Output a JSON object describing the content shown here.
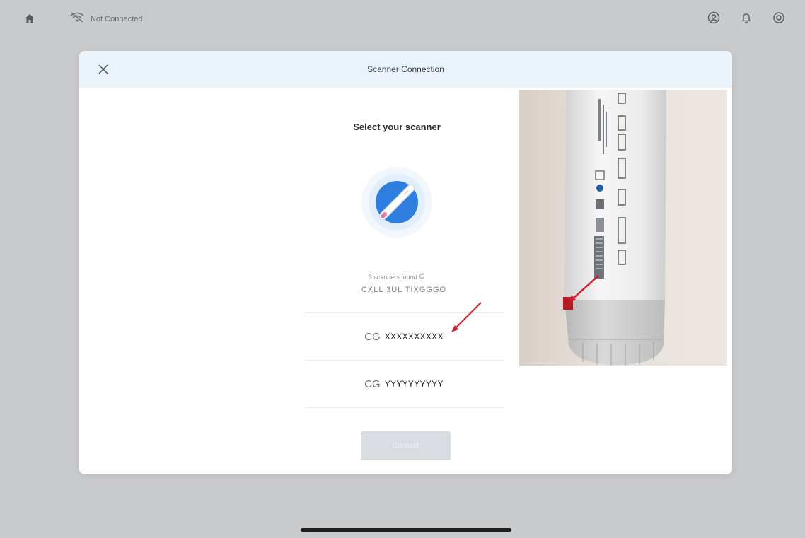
{
  "topbar": {
    "home_icon": "home-icon",
    "connection_icon": "wifi-off-icon",
    "connection_status": "Not Connected",
    "right_icons": [
      "user-icon",
      "bell-icon",
      "settings-icon"
    ]
  },
  "modal": {
    "title": "Scanner Connection",
    "close_icon": "close-icon",
    "heading": "Select your scanner",
    "scanner_icon": "scanner-icon",
    "found_text": "3 scanners found",
    "refresh_icon": "refresh-icon",
    "scanners": [
      {
        "prefix": "",
        "serial": "CXLL 3UL TIXGGGO"
      },
      {
        "prefix": "CG",
        "serial": "XXXXXXXXXX"
      },
      {
        "prefix": "CG",
        "serial": "YYYYYYYYYY"
      }
    ],
    "connect_button": "Connect",
    "colors": {
      "header_bg": "#eaf3fa",
      "accent_blue": "#2f7fe0",
      "annotation_red": "#d7192a",
      "disabled_button": "#d9dde3"
    }
  }
}
